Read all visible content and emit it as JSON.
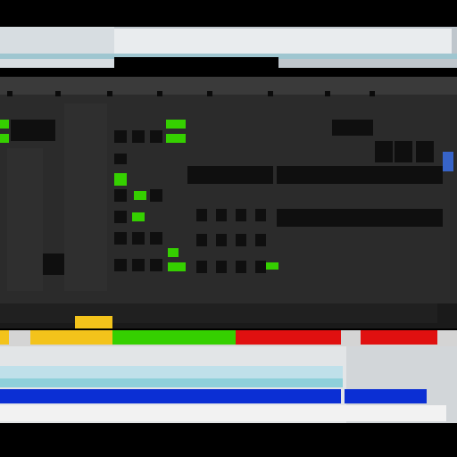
{
  "window": {
    "app_label": "",
    "right_title": ""
  },
  "colors": {
    "accent_green": "#35d000",
    "accent_yellow": "#f3c31b",
    "accent_red": "#e01010",
    "accent_blue": "#0b2fd4"
  },
  "status_bar": {
    "text": ""
  }
}
